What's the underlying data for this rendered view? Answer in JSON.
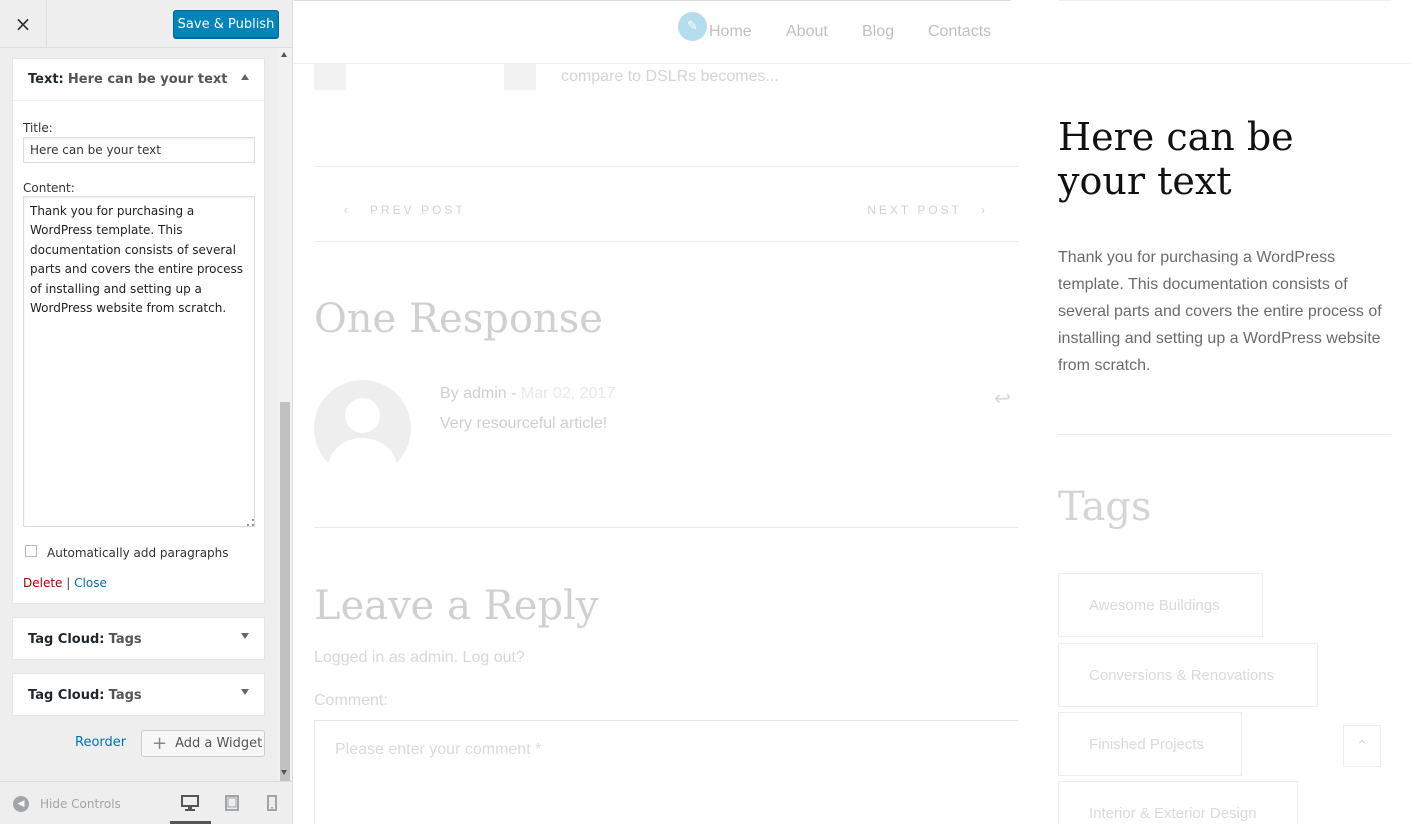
{
  "customizer": {
    "close_label": "×",
    "publish_label": "Save & Publish",
    "text_widget": {
      "type_label": "Text:",
      "name": "Here can be your text",
      "title_label": "Title:",
      "title_value": "Here can be your text",
      "content_label": "Content:",
      "content_value": "Thank you for purchasing a WordPress template. This documentation consists of several parts and covers the entire process of installing and setting up a WordPress website from scratch.",
      "auto_paragraphs_label": "Automatically add paragraphs",
      "delete_label": "Delete",
      "separator": "|",
      "close_label": "Close"
    },
    "tag_widgets": [
      {
        "type_label": "Tag Cloud:",
        "name": "Tags"
      },
      {
        "type_label": "Tag Cloud:",
        "name": "Tags"
      }
    ],
    "reorder_label": "Reorder",
    "add_widget_label": "Add a Widget",
    "footer": {
      "hide_controls_label": "Hide Controls"
    }
  },
  "preview": {
    "nav": {
      "items": [
        "Home",
        "About",
        "Blog",
        "Contacts"
      ]
    },
    "excerpt_text": "compare to DSLRs becomes...",
    "post_nav": {
      "prev_label": "PREV POST",
      "next_label": "NEXT POST"
    },
    "responses_title": "One Response",
    "comment": {
      "author_prefix": "By admin - ",
      "date": "Mar 02, 2017",
      "text": "Very resourceful article!"
    },
    "reply": {
      "title": "Leave a Reply",
      "logged_in_prefix": "Logged in as ",
      "user": "admin",
      "logout": "Log out?",
      "comment_label": "Comment:",
      "comment_placeholder": "Please enter your comment *"
    },
    "sidebar": {
      "widget_title": "Here can be your text",
      "widget_text": "Thank you for purchasing a WordPress template. This documentation consists of several parts and covers the entire process of installing and setting up a WordPress website from scratch.",
      "tags_title": "Tags",
      "tags": [
        "Awesome Buildings",
        "Conversions & Renovations",
        "Finished Projects",
        "Interior & Exterior Design"
      ]
    }
  },
  "colors": {
    "publish_button": "#0085ba",
    "link": "#0073aa",
    "delete": "#aa0000",
    "edit_shortcut": "#b5dced"
  }
}
